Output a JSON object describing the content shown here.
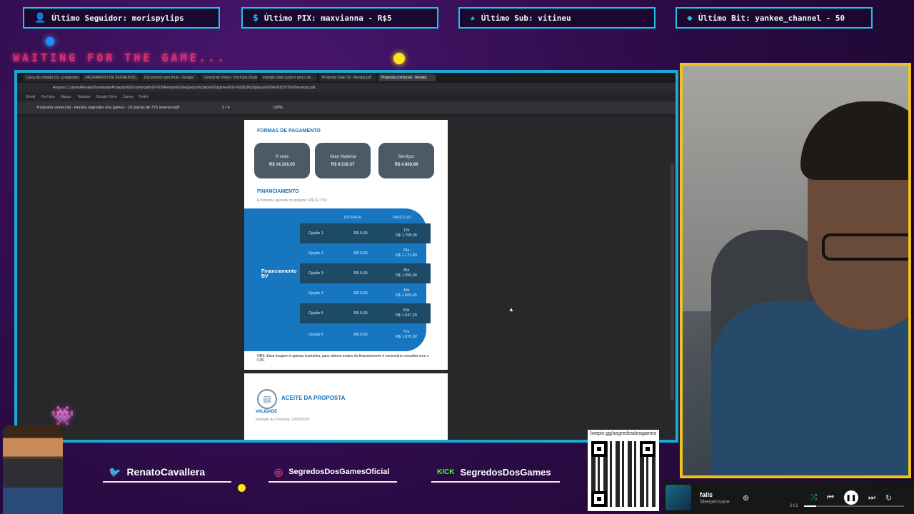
{
  "topbars": [
    {
      "icon": "user-icon",
      "text": "Último Seguidor: morispylips"
    },
    {
      "icon": "dollar-icon",
      "text": "Último PIX: maxvianna - R$5"
    },
    {
      "icon": "star-icon",
      "text": "Último Sub: vitineu"
    },
    {
      "icon": "diamond-icon",
      "text": "Último Bit: yankee_channel - 50"
    }
  ],
  "waiting_text": "WAITING FOR THE GAME...",
  "browser": {
    "tabs": [
      "Caixa de entrada (1) - g.segredos",
      "ORÇAMENTO DE SEGREDOS...",
      "Documento sem título - Google",
      "Central de Vídeo - YouTube Studio",
      "energia solar custo e preço do...",
      "Proposta Solar 02 - Renato.pdf",
      "Proposta comercial - Renato"
    ],
    "address": "Arquivo  C:/Users/Renato/Downloads/Proposta%20comercial%20-%20Renato%20segredos%20dos%20games%20-%2010%20placas%20de%20375%20inversor.pdf",
    "bookmarks": [
      "Gmail",
      "YouTube",
      "Mapas",
      "Tradutor",
      "Google Drive",
      "Canva",
      "Twitch"
    ],
    "pdf_title": "Proposta comercial - Renato segredos dos games - 10 placas de 375 inversor.pdf",
    "pdf_page": "2 / 4",
    "pdf_zoom": "100%"
  },
  "pdf": {
    "section_payment": "FORMAS DE PAGAMENTO",
    "cards": [
      {
        "label": "À vista",
        "value": "R$ 14.320,05"
      },
      {
        "label": "Valor Material",
        "value": "R$ 9.519,37"
      },
      {
        "label": "Serviços",
        "value": "R$ 4.800,68"
      }
    ],
    "section_financing": "FINANCIAMENTO",
    "financing_sub": "Economia gerada no projeto: R$ 617,50",
    "financing_label": "Financiamento BV",
    "col_entrada": "ENTRADA",
    "col_parcela": "PARCELAS",
    "options": [
      {
        "name": "Opção 1",
        "entrada": "R$ 0,00",
        "term": "12x",
        "parcela": "R$ 1.708,05"
      },
      {
        "name": "Opção 2",
        "entrada": "R$ 0,00",
        "term": "24x",
        "parcela": "R$ 1.172,83"
      },
      {
        "name": "Opção 3",
        "entrada": "R$ 0,00",
        "term": "36x",
        "parcela": "R$ 1.050,34"
      },
      {
        "name": "Opção 4",
        "entrada": "R$ 0,00",
        "term": "48x",
        "parcela": "R$ 1.005,65"
      },
      {
        "name": "Opção 5",
        "entrada": "R$ 0,00",
        "term": "60x",
        "parcela": "R$ 1.047,20"
      },
      {
        "name": "Opção 6",
        "entrada": "R$ 0,00",
        "term": "72x",
        "parcela": "R$ 1.070,02"
      }
    ],
    "obs": "OBS: Essa imagem é apenas ilustrativa, para valores exatos do financiamento é necessário consultar com o CPF.",
    "aceite": "ACEITE DA PROPOSTA",
    "validade": "VALIDADE",
    "validade_text": "Emissão da Proposta: 19/08/2024"
  },
  "social": [
    {
      "icon": "twitter-icon",
      "text": "RenatoCavallera"
    },
    {
      "icon": "instagram-icon",
      "text": "SegredosDosGamesOficial"
    },
    {
      "icon": "kick-icon",
      "text": "SegredosDosGames"
    }
  ],
  "qr_url": "livepix.gg/segredosdosgames",
  "player": {
    "track": "falls",
    "artist": "Sleepermane",
    "time": "2:01",
    "progress": 0.12
  },
  "colors": {
    "accent_cyan": "#19c6e6",
    "cam_border": "#f0c21c",
    "financing_blue": "#1776c0"
  }
}
